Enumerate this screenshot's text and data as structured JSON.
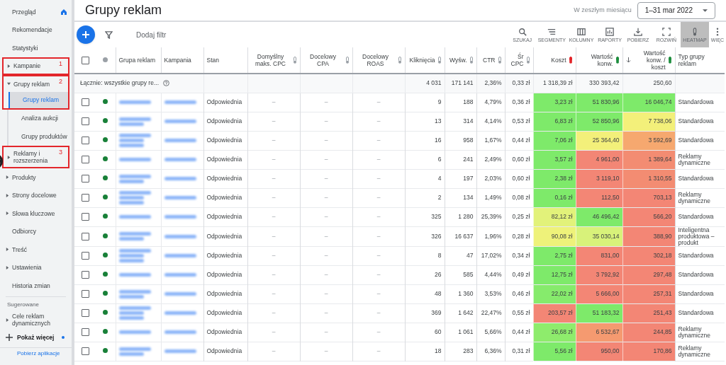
{
  "sidebar": {
    "items": [
      {
        "label": "Przegląd",
        "expandable": false
      },
      {
        "label": "Rekomendacje",
        "expandable": false
      },
      {
        "label": "Statystyki",
        "expandable": false
      },
      {
        "label": "Kampanie",
        "expandable": true,
        "expanded": false,
        "callout": "1"
      },
      {
        "label": "Grupy reklam",
        "expandable": true,
        "expanded": true,
        "callout": "2",
        "children": [
          {
            "label": "Grupy reklam",
            "selected": true,
            "framed": true
          },
          {
            "label": "Analiza aukcji",
            "selected": false,
            "framed": false
          },
          {
            "label": "Grupy produktów",
            "selected": false,
            "framed": false
          }
        ]
      },
      {
        "label": "Reklamy i rozszerzenia",
        "expandable": true,
        "expanded": false,
        "callout": "3"
      },
      {
        "label": "Produkty",
        "expandable": true,
        "expanded": false
      },
      {
        "label": "Strony docelowe",
        "expandable": true,
        "expanded": false
      },
      {
        "label": "Słowa kluczowe",
        "expandable": true,
        "expanded": false
      },
      {
        "label": "Odbiorcy",
        "expandable": false
      },
      {
        "label": "Treść",
        "expandable": true,
        "expanded": false
      },
      {
        "label": "Ustawienia",
        "expandable": true,
        "expanded": false
      },
      {
        "label": "Historia zmian",
        "expandable": false
      }
    ],
    "section_title": "Sugerowane",
    "suggested": [
      {
        "label": "Cele reklam dynamicznych",
        "expandable": true,
        "expanded": false
      }
    ],
    "show_more": "Pokaż więcej",
    "footer_link": "Pobierz aplikacje"
  },
  "header": {
    "title": "Grupy reklam",
    "range_label": "W zeszłym miesiącu",
    "range": "1–31 mar 2022"
  },
  "toolbar": {
    "filter_label": "Dodaj filtr",
    "tools": [
      {
        "label": "SZUKAJ",
        "kind": "search",
        "selected": false
      },
      {
        "label": "SEGMENTY",
        "kind": "segments",
        "selected": false
      },
      {
        "label": "KOLUMNY",
        "kind": "columns",
        "selected": false
      },
      {
        "label": "RAPORTY",
        "kind": "reports",
        "selected": false
      },
      {
        "label": "POBIERZ",
        "kind": "download",
        "selected": false
      },
      {
        "label": "ROZWIŃ",
        "kind": "expand",
        "selected": false
      },
      {
        "label": "HEATMAP",
        "kind": "heatmap",
        "selected": true
      },
      {
        "label": "WIĘC",
        "kind": "more",
        "selected": false
      }
    ]
  },
  "table": {
    "columns": [
      {
        "label": "Grupa reklam",
        "kind": "text"
      },
      {
        "label": "Kampania",
        "kind": "text"
      },
      {
        "label": "Stan",
        "kind": "text"
      },
      {
        "label": "Domyślny maks. CPC",
        "kind": "target"
      },
      {
        "label": "Docelowy CPA",
        "kind": "target"
      },
      {
        "label": "Docelowy ROAS",
        "kind": "target"
      },
      {
        "label": "Kliknięcia",
        "kind": "metric"
      },
      {
        "label": "Wyśw.",
        "kind": "metric"
      },
      {
        "label": "CTR",
        "kind": "metric"
      },
      {
        "label": "Śr CPC",
        "kind": "metric"
      },
      {
        "label": "Koszt",
        "kind": "cost_heat"
      },
      {
        "label": "Wartość konw.",
        "kind": "value_heat"
      },
      {
        "label": "Wartość konw. / koszt",
        "kind": "value_heat",
        "sorted": true
      },
      {
        "label": "Typ grupy reklam",
        "kind": "text"
      }
    ],
    "select_all_checked": false,
    "total": {
      "label": "Łącznie: wszystkie grupy re...",
      "cells": [
        null,
        null,
        null,
        null,
        null,
        null,
        "4 031",
        "171 141",
        "2,36%",
        "0,33 zł",
        "1 318,39 zł",
        "330 393,42",
        "250,60",
        null
      ]
    },
    "rows": [
      {
        "checked": false,
        "enabled": true,
        "cells": [
          null,
          null,
          "Odpowiednia",
          "–",
          "–",
          "–",
          "9",
          "188",
          "4,79%",
          "0,36 zł",
          {
            "text": "3,23 zł",
            "color": "#7eea6a"
          },
          {
            "text": "51 830,96",
            "color": "#7eea6a"
          },
          {
            "text": "16 046,74",
            "color": "#7eea6a"
          },
          "Standardowa"
        ]
      },
      {
        "checked": false,
        "enabled": true,
        "cells": [
          null,
          null,
          "Odpowiednia",
          "–",
          "–",
          "–",
          "13",
          "314",
          "4,14%",
          "0,53 zł",
          {
            "text": "6,83 zł",
            "color": "#7eea6a"
          },
          {
            "text": "52 850,96",
            "color": "#7eea6a"
          },
          {
            "text": "7 738,06",
            "color": "#f3f07a"
          },
          "Standardowa"
        ]
      },
      {
        "checked": false,
        "enabled": true,
        "cells": [
          null,
          null,
          "Odpowiednia",
          "–",
          "–",
          "–",
          "16",
          "958",
          "1,67%",
          "0,44 zł",
          {
            "text": "7,06 zł",
            "color": "#7eea6a"
          },
          {
            "text": "25 364,40",
            "color": "#f3f07a"
          },
          {
            "text": "3 592,69",
            "color": "#f6a86f"
          },
          "Standardowa"
        ]
      },
      {
        "checked": false,
        "enabled": true,
        "cells": [
          null,
          null,
          "Odpowiednia",
          "–",
          "–",
          "–",
          "6",
          "241",
          "2,49%",
          "0,60 zł",
          {
            "text": "3,57 zł",
            "color": "#7eea6a"
          },
          {
            "text": "4 961,00",
            "color": "#f38675"
          },
          {
            "text": "1 389,64",
            "color": "#f38c72"
          },
          "Reklamy dynamiczne"
        ]
      },
      {
        "checked": false,
        "enabled": true,
        "cells": [
          null,
          null,
          "Odpowiednia",
          "–",
          "–",
          "–",
          "4",
          "197",
          "2,03%",
          "0,60 zł",
          {
            "text": "2,38 zł",
            "color": "#7eea6a"
          },
          {
            "text": "3 119,10",
            "color": "#f38675"
          },
          {
            "text": "1 310,55",
            "color": "#f38c72"
          },
          "Standardowa"
        ]
      },
      {
        "checked": false,
        "enabled": true,
        "cells": [
          null,
          null,
          "Odpowiednia",
          "–",
          "–",
          "–",
          "2",
          "134",
          "1,49%",
          "0,08 zł",
          {
            "text": "0,16 zł",
            "color": "#7eea6a"
          },
          {
            "text": "112,50",
            "color": "#f38675"
          },
          {
            "text": "703,13",
            "color": "#f38675"
          },
          "Reklamy dynamiczne"
        ]
      },
      {
        "checked": false,
        "enabled": true,
        "cells": [
          null,
          null,
          "Odpowiednia",
          "–",
          "–",
          "–",
          "325",
          "1 280",
          "25,39%",
          "0,25 zł",
          {
            "text": "82,12 zł",
            "color": "#e2f27a"
          },
          {
            "text": "46 496,42",
            "color": "#7eea6a"
          },
          {
            "text": "566,20",
            "color": "#f38675"
          },
          "Standardowa"
        ]
      },
      {
        "checked": false,
        "enabled": true,
        "cells": [
          null,
          null,
          "Odpowiednia",
          "–",
          "–",
          "–",
          "326",
          "16 637",
          "1,96%",
          "0,28 zł",
          {
            "text": "90,08 zł",
            "color": "#eef27a"
          },
          {
            "text": "35 030,14",
            "color": "#d8f27a"
          },
          {
            "text": "388,90",
            "color": "#f38675"
          },
          "Inteligentna produktowa – produkt"
        ]
      },
      {
        "checked": false,
        "enabled": true,
        "cells": [
          null,
          null,
          "Odpowiednia",
          "–",
          "–",
          "–",
          "8",
          "47",
          "17,02%",
          "0,34 zł",
          {
            "text": "2,75 zł",
            "color": "#7eea6a"
          },
          {
            "text": "831,00",
            "color": "#f38675"
          },
          {
            "text": "302,18",
            "color": "#f38675"
          },
          "Standardowa"
        ]
      },
      {
        "checked": false,
        "enabled": true,
        "cells": [
          null,
          null,
          "Odpowiednia",
          "–",
          "–",
          "–",
          "26",
          "585",
          "4,44%",
          "0,49 zł",
          {
            "text": "12,75 zł",
            "color": "#7eea6a"
          },
          {
            "text": "3 792,92",
            "color": "#f38675"
          },
          {
            "text": "297,48",
            "color": "#f38675"
          },
          "Standardowa"
        ]
      },
      {
        "checked": false,
        "enabled": true,
        "cells": [
          null,
          null,
          "Odpowiednia",
          "–",
          "–",
          "–",
          "48",
          "1 360",
          "3,53%",
          "0,46 zł",
          {
            "text": "22,02 zł",
            "color": "#86eb6c"
          },
          {
            "text": "5 666,00",
            "color": "#f38675"
          },
          {
            "text": "257,31",
            "color": "#f38675"
          },
          "Standardowa"
        ]
      },
      {
        "checked": false,
        "enabled": true,
        "cells": [
          null,
          null,
          "Odpowiednia",
          "–",
          "–",
          "–",
          "369",
          "1 642",
          "22,47%",
          "0,55 zł",
          {
            "text": "203,57 zł",
            "color": "#f38675"
          },
          {
            "text": "51 183,32",
            "color": "#7eea6a"
          },
          {
            "text": "251,43",
            "color": "#f38675"
          },
          "Standardowa"
        ]
      },
      {
        "checked": false,
        "enabled": true,
        "cells": [
          null,
          null,
          "Odpowiednia",
          "–",
          "–",
          "–",
          "60",
          "1 061",
          "5,66%",
          "0,44 zł",
          {
            "text": "26,68 zł",
            "color": "#8eec6c"
          },
          {
            "text": "6 532,67",
            "color": "#f59a70"
          },
          {
            "text": "244,85",
            "color": "#f38675"
          },
          "Reklamy dynamiczne"
        ]
      },
      {
        "checked": false,
        "enabled": true,
        "cells": [
          null,
          null,
          "Odpowiednia",
          "–",
          "–",
          "–",
          "18",
          "283",
          "6,36%",
          "0,31 zł",
          {
            "text": "5,56 zł",
            "color": "#7eea6a"
          },
          {
            "text": "950,00",
            "color": "#f38675"
          },
          {
            "text": "170,86",
            "color": "#f38675"
          },
          "Reklamy dynamiczne"
        ]
      }
    ]
  }
}
